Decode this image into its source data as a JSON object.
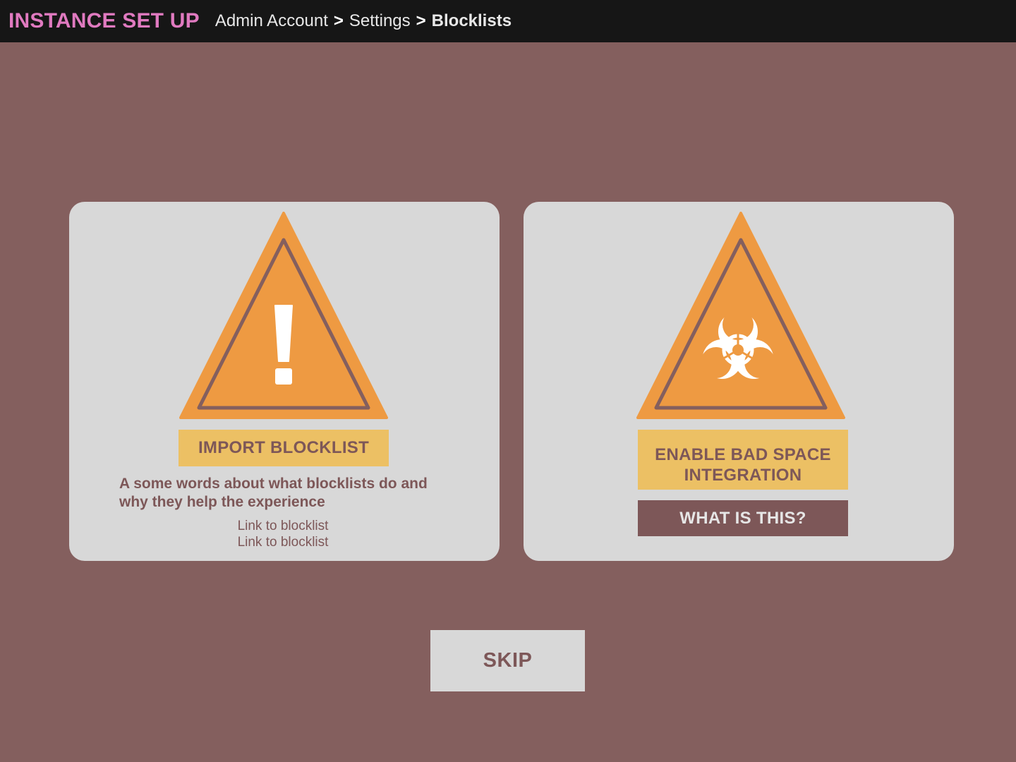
{
  "header": {
    "app_title": "INSTANCE SET UP",
    "breadcrumb": [
      "Admin Account",
      "Settings",
      "Blocklists"
    ],
    "separator": ">"
  },
  "cards": {
    "import": {
      "icon": "warning-exclamation-icon",
      "button_label": "IMPORT BLOCKLIST",
      "description": "A some words about what blocklists do and why they help the experience",
      "links": [
        "Link to blocklist",
        "Link to blocklist"
      ]
    },
    "badspace": {
      "icon": "biohazard-warning-icon",
      "button_label_line1": "ENABLE BAD SPACE",
      "button_label_line2": "INTEGRATION",
      "info_button_label": "WHAT IS THIS?"
    }
  },
  "footer": {
    "skip_label": "SKIP"
  },
  "colors": {
    "background": "#845f5e",
    "topbar": "#161616",
    "title_pink": "#e07ac0",
    "card": "#d8d8d8",
    "warning_orange": "#ee9a42",
    "button_yellow": "#ecc064",
    "mauve": "#7d5758"
  }
}
